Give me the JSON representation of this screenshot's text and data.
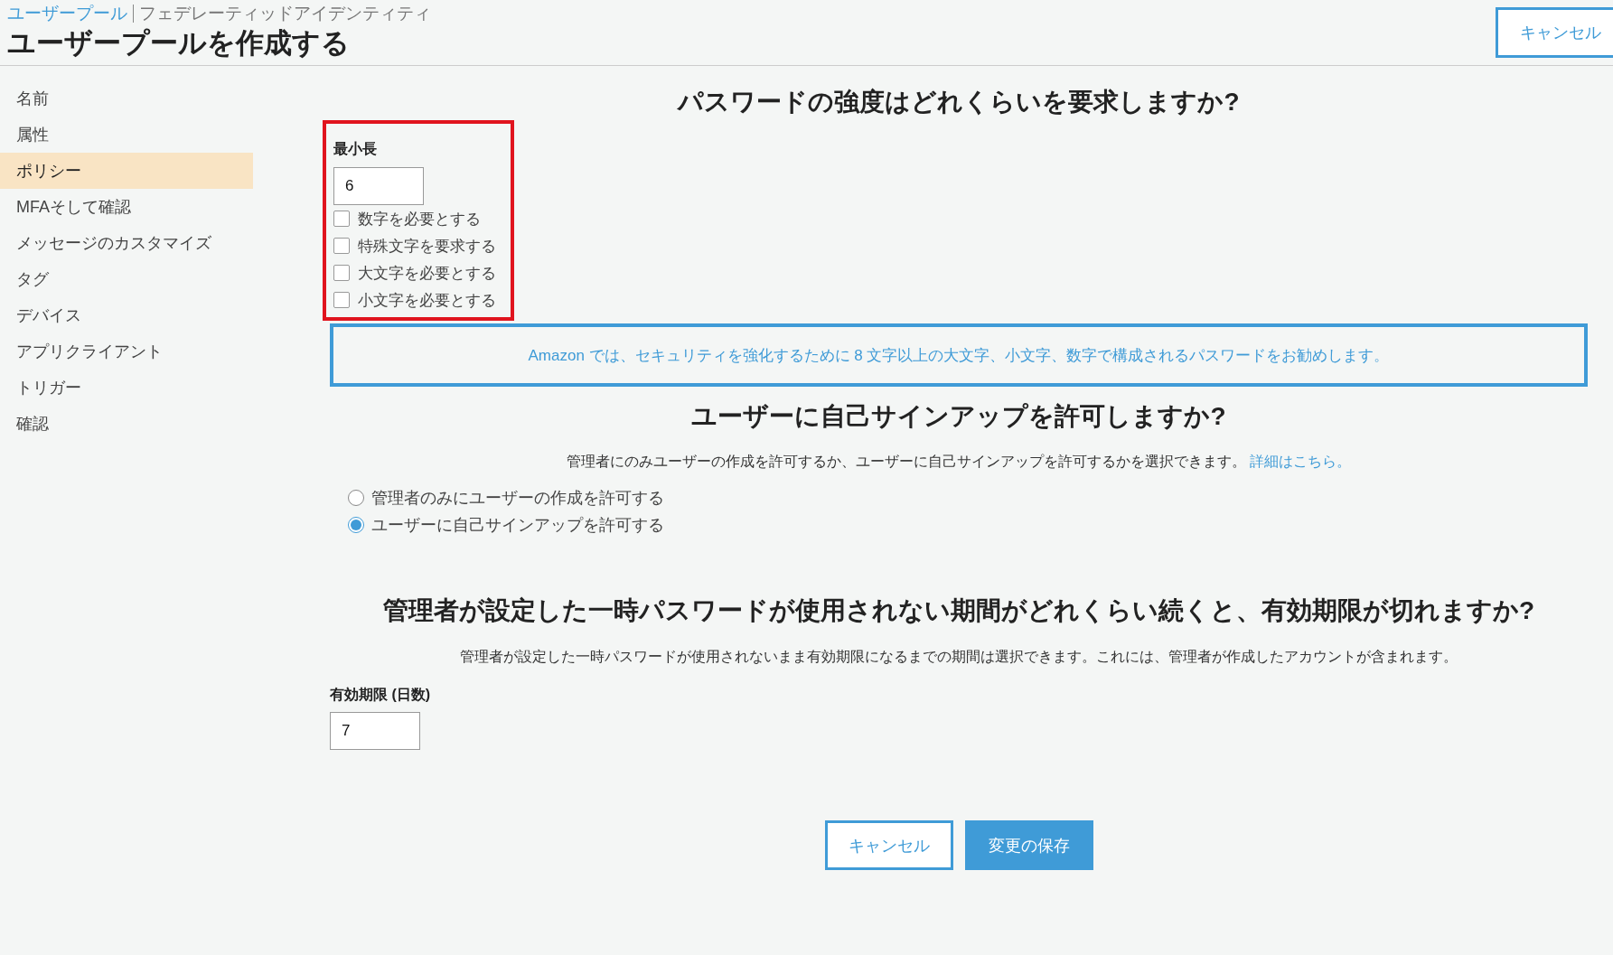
{
  "header": {
    "breadcrumb": [
      {
        "label": "ユーザープール",
        "link": true
      },
      {
        "label": "フェデレーティッドアイデンティティ",
        "link": false
      }
    ],
    "title": "ユーザープールを作成する",
    "cancel_button": "キャンセル"
  },
  "sidebar": {
    "items": [
      {
        "label": "名前",
        "selected": false
      },
      {
        "label": "属性",
        "selected": false
      },
      {
        "label": "ポリシー",
        "selected": true
      },
      {
        "label": "MFAそして確認",
        "selected": false
      },
      {
        "label": "メッセージのカスタマイズ",
        "selected": false
      },
      {
        "label": "タグ",
        "selected": false
      },
      {
        "label": "デバイス",
        "selected": false
      },
      {
        "label": "アプリクライアント",
        "selected": false
      },
      {
        "label": "トリガー",
        "selected": false
      },
      {
        "label": "確認",
        "selected": false
      }
    ]
  },
  "password_strength": {
    "heading": "パスワードの強度はどれくらいを要求しますか?",
    "highlighted": true,
    "min_length": {
      "label": "最小長",
      "value": "6"
    },
    "requirements": [
      {
        "label": "数字を必要とする",
        "checked": false
      },
      {
        "label": "特殊文字を要求する",
        "checked": false
      },
      {
        "label": "大文字を必要とする",
        "checked": false
      },
      {
        "label": "小文字を必要とする",
        "checked": false
      }
    ],
    "info": "Amazon では、セキュリティを強化するために 8 文字以上の大文字、小文字、数字で構成されるパスワードをお勧めします。"
  },
  "self_signup": {
    "heading": "ユーザーに自己サインアップを許可しますか?",
    "description": "管理者にのみユーザーの作成を許可するか、ユーザーに自己サインアップを許可するかを選択できます。",
    "link": "詳細はこちら。",
    "options": [
      {
        "label": "管理者のみにユーザーの作成を許可する",
        "selected": false
      },
      {
        "label": "ユーザーに自己サインアップを許可する",
        "selected": true
      }
    ]
  },
  "temp_password": {
    "heading": "管理者が設定した一時パスワードが使用されない期間がどれくらい続くと、有効期限が切れますか?",
    "description": "管理者が設定した一時パスワードが使用されないまま有効期限になるまでの期間は選択できます。これには、管理者が作成したアカウントが含まれます。",
    "expiry": {
      "label": "有効期限 (日数)",
      "value": "7"
    }
  },
  "footer": {
    "cancel_button": "キャンセル",
    "save_button": "変更の保存"
  }
}
